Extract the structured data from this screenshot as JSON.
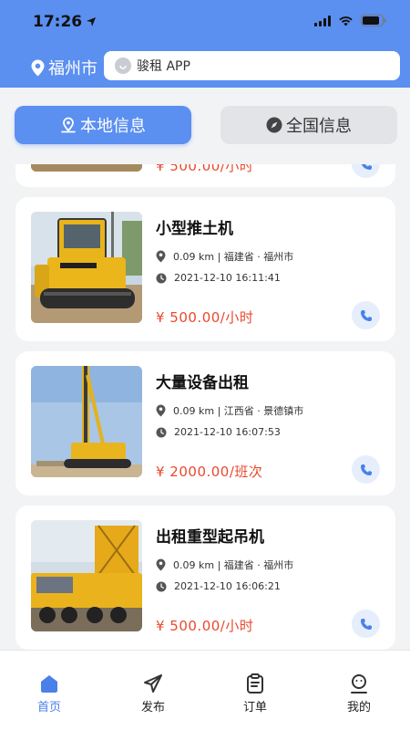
{
  "status": {
    "time": "17:26"
  },
  "header": {
    "city": "福州市",
    "search_text": "骏租 APP"
  },
  "tabs": [
    {
      "label": "本地信息",
      "active": true
    },
    {
      "label": "全国信息",
      "active": false
    }
  ],
  "partial_card": {
    "price": "¥ 500.00/小时"
  },
  "listings": [
    {
      "title": "小型推土机",
      "distance": "0.09 km",
      "location": "福建省 · 福州市",
      "time": "2021-12-10 16:11:41",
      "price": "¥ 500.00/小时",
      "image": "yellow-bulldozer"
    },
    {
      "title": "大量设备出租",
      "distance": "0.09 km",
      "location": "江西省 · 景德镇市",
      "time": "2021-12-10 16:07:53",
      "price": "¥ 2000.00/班次",
      "image": "rotary-drilling-rig"
    },
    {
      "title": "出租重型起吊机",
      "distance": "0.09 km",
      "location": "福建省 · 福州市",
      "time": "2021-12-10 16:06:21",
      "price": "¥ 500.00/小时",
      "image": "heavy-crane-truck"
    }
  ],
  "tabbar": [
    {
      "label": "首页",
      "icon": "home-icon",
      "active": true
    },
    {
      "label": "发布",
      "icon": "send-icon",
      "active": false
    },
    {
      "label": "订单",
      "icon": "clipboard-icon",
      "active": false
    },
    {
      "label": "我的",
      "icon": "user-icon",
      "active": false
    }
  ],
  "colors": {
    "primary": "#5b8ff0",
    "price": "#e8492f",
    "accent": "#4a80ea"
  }
}
